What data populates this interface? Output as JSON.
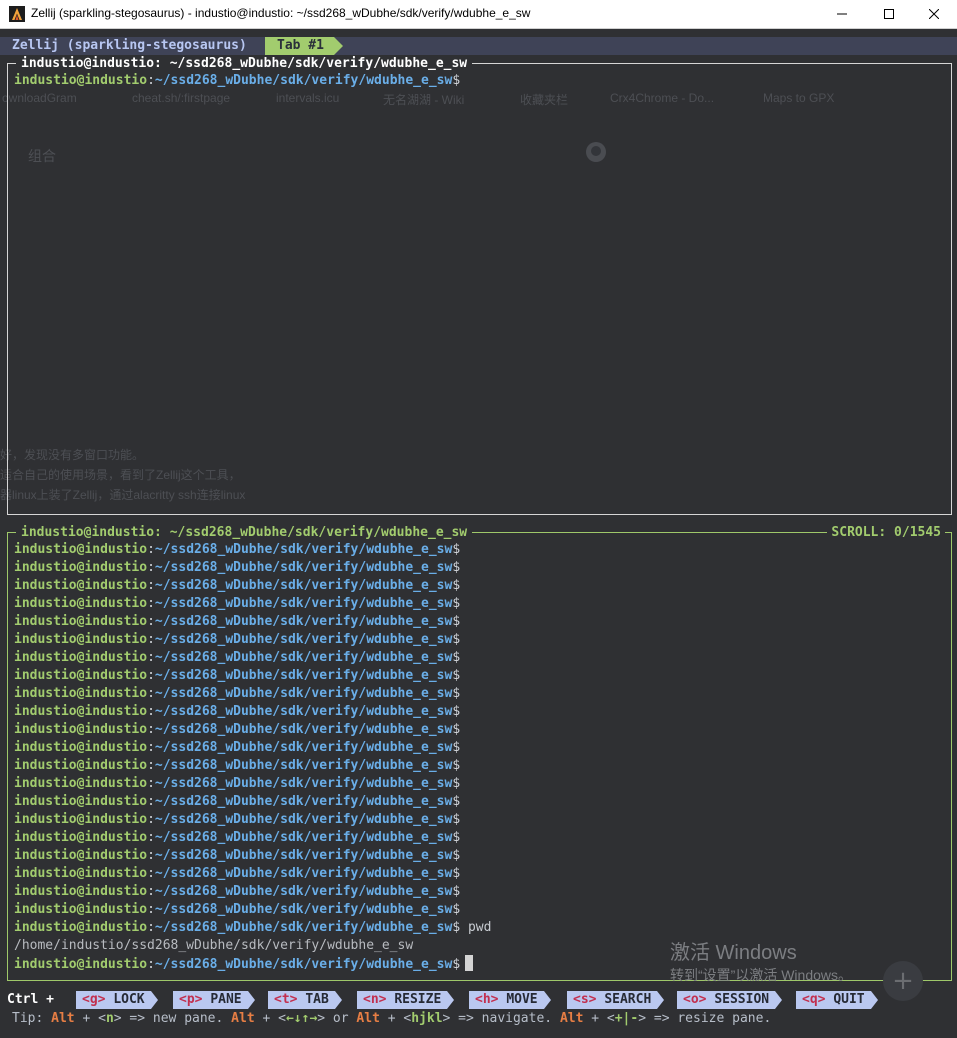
{
  "window": {
    "title": "Zellij (sparkling-stegosaurus) - industio@industio: ~/ssd268_wDubhe/sdk/verify/wdubhe_e_sw",
    "controls": {
      "minimize": "—",
      "maximize": "☐",
      "close": "✕"
    }
  },
  "tabbar": {
    "session": "Zellij (sparkling-stegosaurus)",
    "active_tab": "Tab #1"
  },
  "pane_top": {
    "title": "industio@industio: ~/ssd268_wDubhe/sdk/verify/wdubhe_e_sw",
    "lines": [
      {
        "user": "industio@industio",
        "sep": ":",
        "path": "~/ssd268_wDubhe/sdk/verify/wdubhe_e_sw",
        "suffix": "$"
      }
    ]
  },
  "pane_bottom": {
    "title": "industio@industio: ~/ssd268_wDubhe/sdk/verify/wdubhe_e_sw",
    "scroll_label": "SCROLL:  0/1545",
    "prompt": {
      "user": "industio@industio",
      "sep": ":",
      "path": "~/ssd268_wDubhe/sdk/verify/wdubhe_e_sw",
      "suffix": "$"
    },
    "prompt_repeat_count": 21,
    "command": "pwd",
    "output": "/home/industio/ssd268_wDubhe/sdk/verify/wdubhe_e_sw"
  },
  "background_ghost": {
    "bookmarks": [
      "ownloadGram",
      "cheat.sh/:firstpage",
      "intervals.icu",
      "无名湖湖 - Wiki",
      "收藏夹栏",
      "Crx4Chrome - Do...",
      "Maps to GPX"
    ],
    "ghost_word": "组合",
    "text_lines": [
      "好，发现没有多窗口功能。",
      "适合自己的使用场景，看到了Zellij这个工具，",
      "器linux上装了Zellij，通过alacritty ssh连接linux"
    ]
  },
  "keybar": {
    "modifier": "Ctrl +",
    "items": [
      {
        "key": "<g>",
        "label": "LOCK"
      },
      {
        "key": "<p>",
        "label": "PANE"
      },
      {
        "key": "<t>",
        "label": "TAB"
      },
      {
        "key": "<n>",
        "label": "RESIZE"
      },
      {
        "key": "<h>",
        "label": "MOVE"
      },
      {
        "key": "<s>",
        "label": "SEARCH"
      },
      {
        "key": "<o>",
        "label": "SESSION"
      },
      {
        "key": "<q>",
        "label": "QUIT"
      }
    ]
  },
  "tip": {
    "prefix": "Tip: ",
    "alt1": "Alt",
    "t1": " + <",
    "k1": "n",
    "t2": "> => new pane. ",
    "alt2": "Alt",
    "t3": " + <",
    "k2": "←↓↑→",
    "t4": "> or ",
    "alt3": "Alt",
    "t5": " + <",
    "k3": "hjkl",
    "t6": "> => navigate. ",
    "alt4": "Alt",
    "t7": " + <",
    "k4": "+|-",
    "t8": "> => resize pane."
  },
  "watermark": {
    "line1": "激活 Windows",
    "line2": "转到“设置”以激活 Windows。"
  },
  "colors": {
    "accent_green": "#a2cc6e",
    "path_blue": "#6aaee8",
    "key_red": "#c22f4f",
    "alt_orange": "#e77e44"
  }
}
